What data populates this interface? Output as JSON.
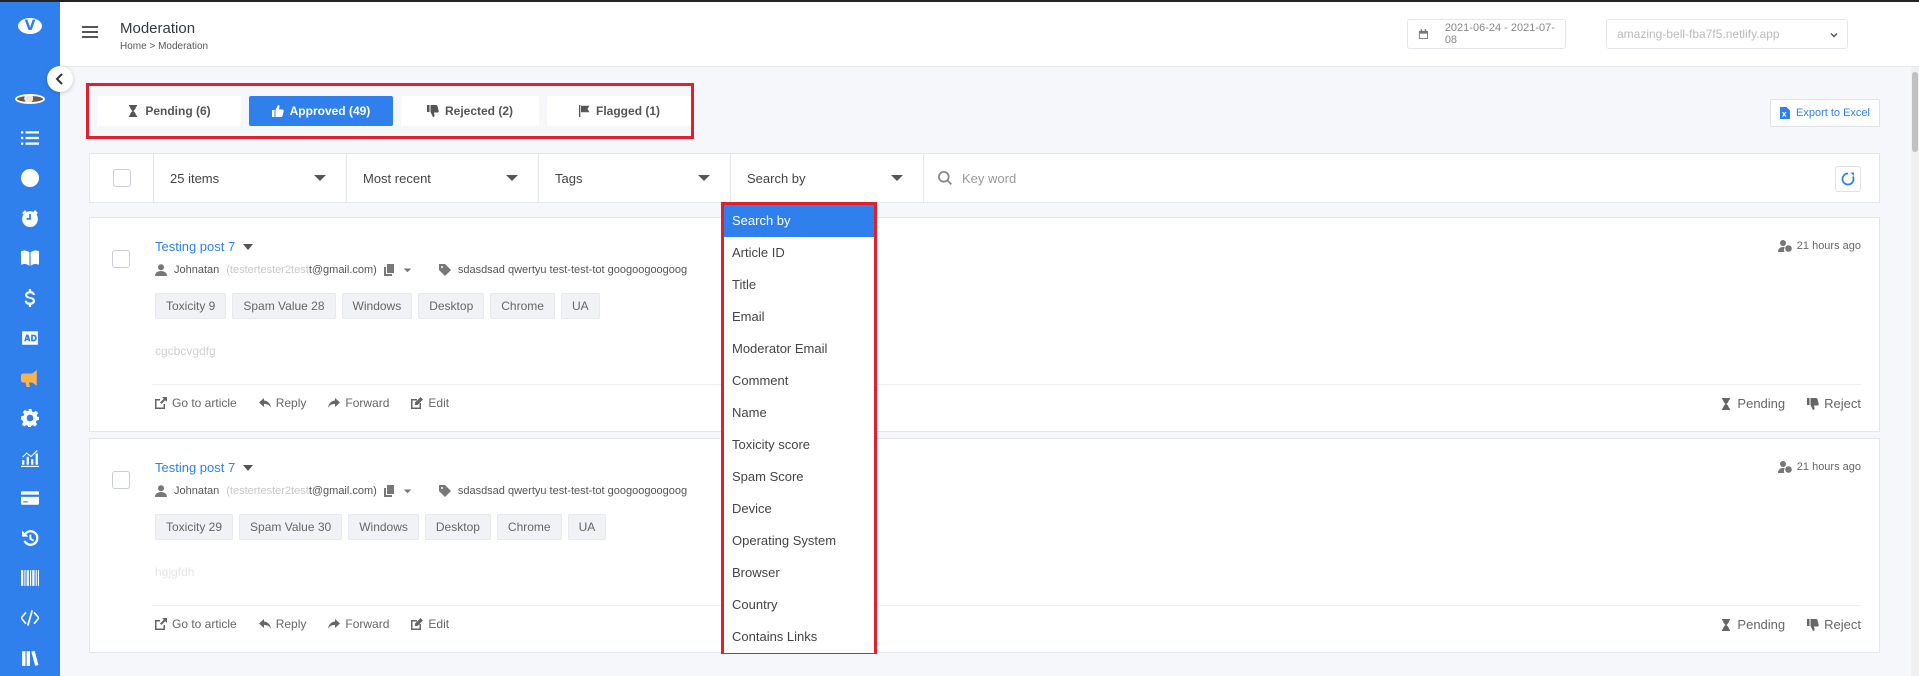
{
  "header": {
    "title": "Moderation",
    "breadcrumb": "Home  > Moderation",
    "date_range": "2021-06-24 - 2021-07-08",
    "site": "amazing-bell-fba7f5.netlify.app"
  },
  "sidebar": {
    "logo": "V",
    "icons": [
      "list-icon",
      "clock-icon",
      "alarm-icon",
      "book-icon",
      "dollar-icon",
      "ad-icon",
      "megaphone-icon",
      "gear-icon",
      "chart-icon",
      "card-icon",
      "history-icon",
      "barcode-icon",
      "code-icon",
      "books-icon"
    ],
    "active_color": "#fbb24b"
  },
  "tabs": [
    {
      "label": "Pending (6)",
      "icon": "hourglass-icon"
    },
    {
      "label": "Approved (49)",
      "icon": "thumbs-up-icon",
      "active": true
    },
    {
      "label": "Rejected (2)",
      "icon": "thumbs-down-icon"
    },
    {
      "label": "Flagged (1)",
      "icon": "flag-icon"
    }
  ],
  "export_label": "Export to Excel",
  "filters": {
    "items": "25 items",
    "sort": "Most recent",
    "tags": "Tags",
    "search_by": "Search by",
    "keyword_placeholder": "Key word"
  },
  "dropdown": {
    "options": [
      "Search by",
      "Article ID",
      "Title",
      "Email",
      "Moderator Email",
      "Comment",
      "Name",
      "Toxicity score",
      "Spam Score",
      "Device",
      "Operating System",
      "Browser",
      "Country",
      "Contains Links"
    ]
  },
  "posts": [
    {
      "title": "Testing post 7",
      "author": "Johnatan",
      "email_blur": "(testertester2test",
      "email_domain": "t@gmail.com)",
      "tags": "sdasdsad   qwertyu test-test-tot   googoogoogoog",
      "chips": [
        "Toxicity 9",
        "Spam Value 28",
        "Windows",
        "Desktop",
        "Chrome",
        "UA"
      ],
      "comment": "cgcbcvgdfg",
      "time": "21 hours ago"
    },
    {
      "title": "Testing post 7",
      "author": "Johnatan",
      "email_blur": "(testertester2test",
      "email_domain": "t@gmail.com)",
      "tags": "sdasdsad   qwertyu test-test-tot   googoogoogoog",
      "chips": [
        "Toxicity 29",
        "Spam Value 30",
        "Windows",
        "Desktop",
        "Chrome",
        "UA"
      ],
      "comment": "hgjgfdh",
      "time": "21 hours ago"
    }
  ],
  "actions": {
    "go": "Go to article",
    "reply": "Reply",
    "forward": "Forward",
    "edit": "Edit",
    "pending": "Pending",
    "reject": "Reject"
  },
  "colors": {
    "primary": "#2f80ed",
    "highlight": "#e0202a"
  }
}
